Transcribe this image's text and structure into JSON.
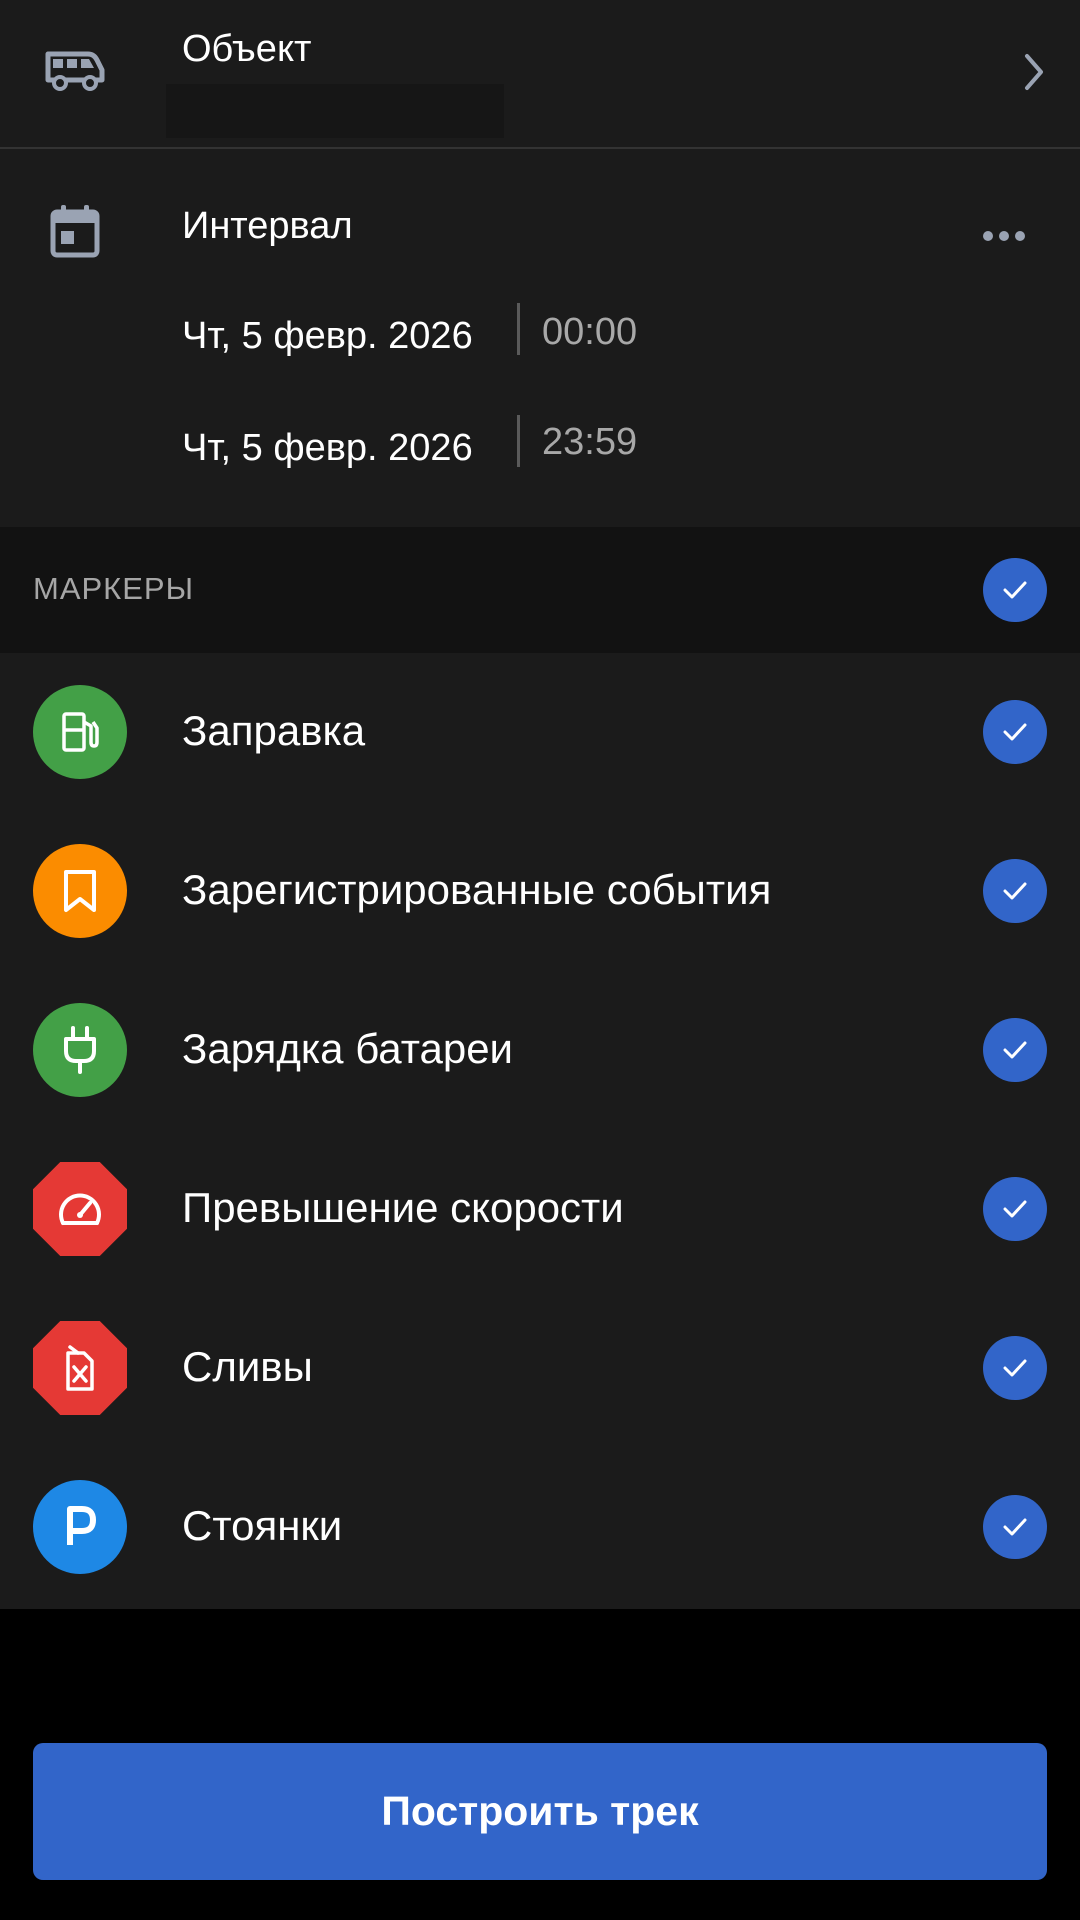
{
  "object": {
    "label": "Объект",
    "icon": "van-icon"
  },
  "interval": {
    "label": "Интервал",
    "icon": "calendar-icon",
    "from": {
      "date": "Чт, 5 февр. 2026",
      "time": "00:00"
    },
    "to": {
      "date": "Чт, 5 февр. 2026",
      "time": "23:59"
    }
  },
  "markers": {
    "title": "МАРКЕРЫ",
    "all_checked": true,
    "items": [
      {
        "label": "Заправка",
        "icon": "fuel-pump-icon",
        "color": "#43a047",
        "checked": true
      },
      {
        "label": "Зарегистрированные события",
        "icon": "bookmark-icon",
        "color": "#fb8c00",
        "checked": true
      },
      {
        "label": "Зарядка батареи",
        "icon": "plug-icon",
        "color": "#43a047",
        "checked": true
      },
      {
        "label": "Превышение скорости",
        "icon": "speedometer-icon",
        "color": "#e53935",
        "checked": true
      },
      {
        "label": "Сливы",
        "icon": "fuel-canister-drain-icon",
        "color": "#e53935",
        "checked": true
      },
      {
        "label": "Стоянки",
        "icon": "parking-icon",
        "color": "#1e88e5",
        "checked": true
      }
    ]
  },
  "build_button": {
    "label": "Построить трек"
  },
  "colors": {
    "accent": "#3265c9",
    "panel": "#1b1b1b",
    "header": "#121212"
  }
}
